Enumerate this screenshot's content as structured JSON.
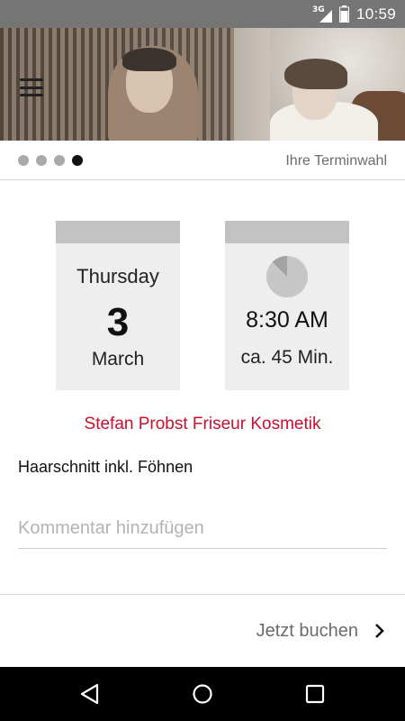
{
  "status_bar": {
    "network": "3G",
    "time": "10:59",
    "color": "#757575",
    "icons": [
      "signal-icon",
      "battery-icon"
    ]
  },
  "header": {
    "menu_icon": "hamburger-menu-icon",
    "hero_image": "hero-photo"
  },
  "steps": {
    "total": 4,
    "active_index": 3,
    "label": "Ihre Terminwahl"
  },
  "appointment": {
    "weekday": "Thursday",
    "day": "3",
    "month": "March",
    "time": "8:30 AM",
    "duration": "ca. 45 Min.",
    "clock_icon": "clock-icon"
  },
  "salon": {
    "name": "Stefan Probst Friseur Kosmetik",
    "color": "#c8102e"
  },
  "service": {
    "name": "Haarschnitt inkl. Föhnen"
  },
  "comment": {
    "placeholder": "Kommentar hinzufügen",
    "value": ""
  },
  "action": {
    "book_label": "Jetzt buchen",
    "icon": "chevron-right-icon"
  },
  "nav_bar": {
    "buttons": [
      "back-icon",
      "home-icon",
      "recent-apps-icon"
    ]
  }
}
